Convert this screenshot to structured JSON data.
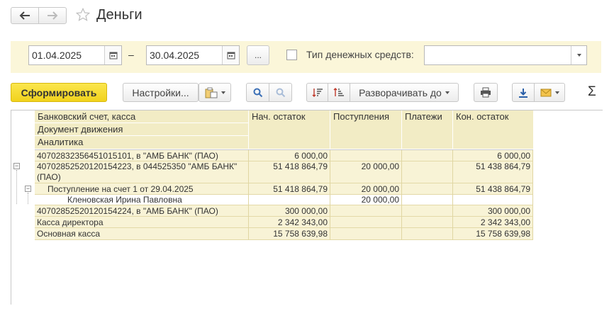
{
  "header": {
    "title": "Деньги",
    "back_icon": "arrow-left-icon",
    "forward_icon": "arrow-right-icon",
    "favorite_icon": "star-icon"
  },
  "filters": {
    "date_from": "01.04.2025",
    "dash": "–",
    "date_to": "30.04.2025",
    "period_button": "...",
    "cash_type_label": "Тип денежных средств:",
    "cash_type_value": ""
  },
  "toolbar": {
    "generate": "Сформировать",
    "settings": "Настройки...",
    "expand_to": "Разворачивать до",
    "sigma": "Σ"
  },
  "table": {
    "headers": {
      "row1": "Банковский счет, касса",
      "row2": "Документ движения",
      "row3": "Аналитика",
      "opening": "Нач. остаток",
      "receipts": "Поступления",
      "payments": "Платежи",
      "closing": "Кон. остаток"
    },
    "rows": [
      {
        "name": "40702832356451015101, в \"АМБ БАНК\" (ПАО)",
        "opening": "6 000,00",
        "receipts": "",
        "payments": "",
        "closing": "6 000,00"
      },
      {
        "name": "40702852520120154223, в 044525350 \"АМБ БАНК\"",
        "name2": "(ПАО)",
        "opening": "51 418 864,79",
        "receipts": "20 000,00",
        "payments": "",
        "closing": "51 438 864,79"
      },
      {
        "name": "Поступление на счет 1 от 29.04.2025",
        "opening": "51 418 864,79",
        "receipts": "20 000,00",
        "payments": "",
        "closing": "51 438 864,79"
      },
      {
        "name": "Кленовская Ирина Павловна",
        "opening": "",
        "receipts": "20 000,00",
        "payments": "",
        "closing": ""
      },
      {
        "name": "40702852520120154224, в \"АМБ БАНК\" (ПАО)",
        "opening": "300 000,00",
        "receipts": "",
        "payments": "",
        "closing": "300 000,00"
      },
      {
        "name": "Касса директора",
        "opening": "2 342 343,00",
        "receipts": "",
        "payments": "",
        "closing": "2 342 343,00"
      },
      {
        "name": "Основная касса",
        "opening": "15 758 639,98",
        "receipts": "",
        "payments": "",
        "closing": "15 758 639,98"
      }
    ]
  }
}
